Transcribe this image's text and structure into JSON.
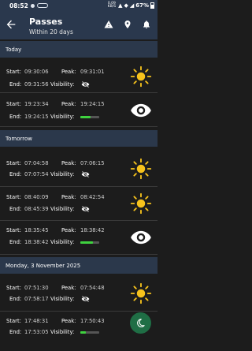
{
  "status_bar": {
    "time": "08:52",
    "speed_value": "0.09",
    "speed_unit": "KB/S",
    "battery": "67%"
  },
  "header": {
    "title": "Passes",
    "subtitle": "Within 20 days"
  },
  "labels": {
    "start": "Start:",
    "end": "End:",
    "peak": "Peak:",
    "visibility": "Visibility:"
  },
  "colors": {
    "header_bg": "#2a384d",
    "section_bg": "#2b384b",
    "row_bg": "#1c1c1c",
    "sun": "#f6c21c",
    "visibility_bar": "#3fd23f",
    "fab_bg": "#1f6e45"
  },
  "sections": [
    {
      "title": "Today",
      "passes": [
        {
          "start": "09:30:06",
          "peak": "09:31:01",
          "end": "09:31:56",
          "visibility": "hidden",
          "visibility_icon": "eye-off-icon",
          "side_icon": "sun-icon"
        },
        {
          "start": "19:23:34",
          "peak": "19:24:15",
          "end": "19:24:15",
          "visibility": "bar",
          "visibility_level": 0.55,
          "side_icon": "eye-icon"
        }
      ]
    },
    {
      "title": "Tomorrow",
      "passes": [
        {
          "start": "07:04:58",
          "peak": "07:06:15",
          "end": "07:07:54",
          "visibility": "hidden",
          "visibility_icon": "eye-off-icon",
          "side_icon": "sun-icon"
        },
        {
          "start": "08:40:09",
          "peak": "08:42:54",
          "end": "08:45:39",
          "visibility": "hidden",
          "visibility_icon": "eye-off-icon",
          "side_icon": "sun-icon"
        },
        {
          "start": "18:35:45",
          "peak": "18:38:42",
          "end": "18:38:42",
          "visibility": "bar",
          "visibility_level": 0.65,
          "side_icon": "eye-icon"
        }
      ]
    },
    {
      "title": "Monday, 3 November 2025",
      "passes": [
        {
          "start": "07:51:30",
          "peak": "07:54:48",
          "end": "07:58:17",
          "visibility": "hidden",
          "visibility_icon": "eye-off-icon",
          "side_icon": "sun-icon"
        },
        {
          "start": "17:48:31",
          "peak": "17:50:43",
          "end": "17:53:05",
          "visibility": "bar",
          "visibility_level": 0.3,
          "side_icon": "sun-icon"
        }
      ]
    }
  ],
  "fab": {
    "icon": "moon-icon"
  }
}
